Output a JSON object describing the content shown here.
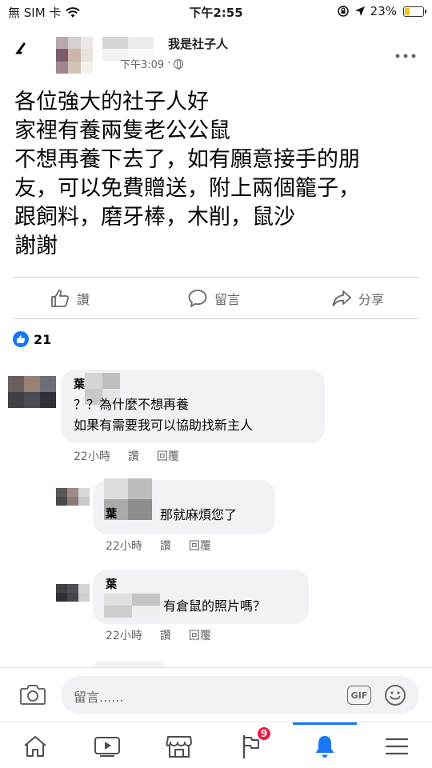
{
  "status_bar": {
    "carrier": "無 SIM 卡",
    "time": "下午2:55",
    "battery_percent": "23%"
  },
  "post": {
    "group_name": "我是社子人",
    "time": "下午3:09",
    "lines": [
      "各位強大的社子人好",
      "家裡有養兩隻老公公鼠",
      "不想再養下去了，如有願意接手的朋",
      "友，可以免費贈送，附上兩個籠子，",
      "跟飼料，磨牙棒，木削，鼠沙",
      "謝謝"
    ]
  },
  "actions": {
    "like": "讚",
    "comment": "留言",
    "share": "分享"
  },
  "reactions": {
    "count": "21"
  },
  "comments": [
    {
      "name": "葉",
      "lines": [
        "？？為什麼不想再養",
        "如果有需要我可以協助找新主人"
      ],
      "time": "22小時",
      "like": "讚",
      "reply": "回覆"
    },
    {
      "name": "葉",
      "lines": [
        "那就麻煩您了"
      ],
      "time": "22小時",
      "like": "讚",
      "reply": "回覆"
    },
    {
      "name": "葉",
      "lines": [
        "有倉鼠的照片嗎？"
      ],
      "time": "22小時",
      "like": "讚",
      "reply": "回覆"
    }
  ],
  "composer": {
    "placeholder": "留言......",
    "gif": "GIF"
  },
  "nav": {
    "notifications_badge": "9"
  },
  "colors": {
    "brand": "#1877f2",
    "badge": "#e41e3f",
    "battery": "#f5c518"
  }
}
